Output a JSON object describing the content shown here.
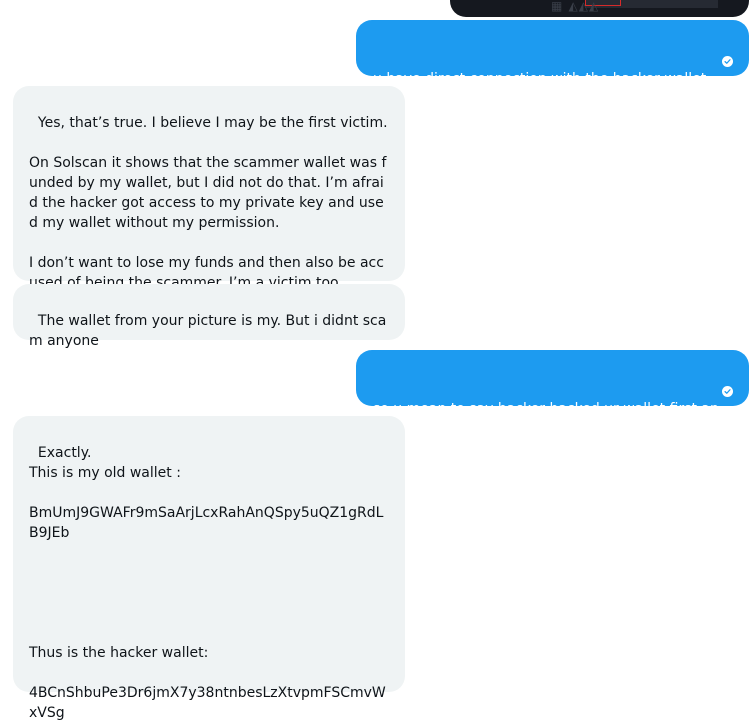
{
  "conversation": {
    "messages": [
      {
        "id": "m1",
        "side": "sent",
        "text": "u have direct connection with the hacker wallet",
        "seen_icon": "check-circle-icon"
      },
      {
        "id": "m2",
        "side": "received",
        "text": "Yes, that’s true. I believe I may be the first victim.\n\nOn Solscan it shows that the scammer wallet was funded by my wallet, but I did not do that. I’m afraid the hacker got access to my private key and used my wallet without my permission.\n\nI don’t want to lose my funds and then also be accused of being the scammer. I’m a victim too."
      },
      {
        "id": "m3",
        "side": "received",
        "text": "The wallet from your picture is my. But i didnt scam anyone"
      },
      {
        "id": "m4",
        "side": "sent",
        "text": "so u mean to say hacker hacked ur wallet first and then transfer that money to that wallet?",
        "seen_icon": "check-circle-icon"
      },
      {
        "id": "m5",
        "side": "received",
        "text": "Exactly.\nThis is my old wallet :\n\nBmUmJ9GWAFr9mSaArjLcxRahAnQSpy5uQZ1gRdLB9JEb\n\n\n\n\n\nThus is the hacker wallet:\n\n4BCnShbuPe3Dr6jmX7y38ntnbesLzXtvpmFSCmvWxVSg"
      }
    ]
  },
  "colors": {
    "sent_bubble": "#1d9bf0",
    "received_bubble": "#eff3f4",
    "text_dark": "#0f1419",
    "image_background": "#15181f"
  }
}
